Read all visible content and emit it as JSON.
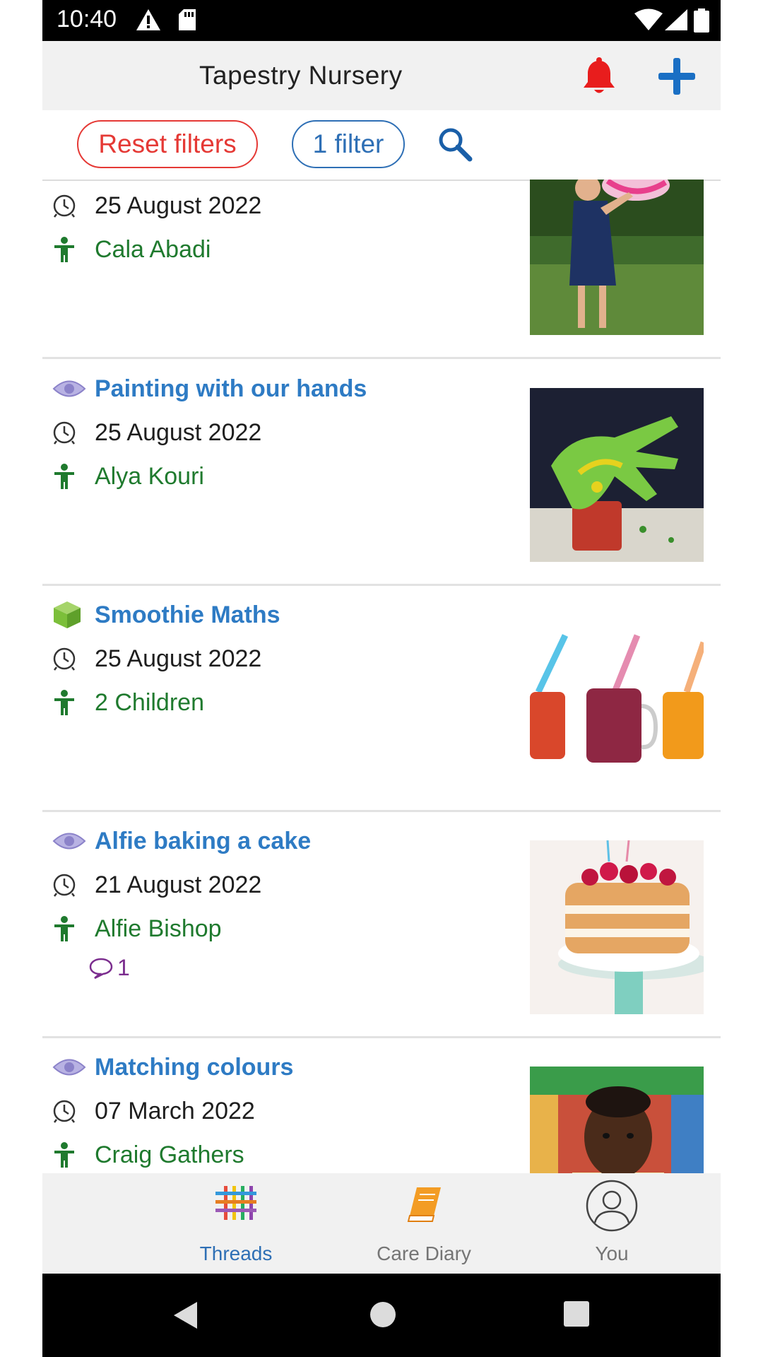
{
  "status_bar": {
    "time": "10:40"
  },
  "app_bar": {
    "title": "Tapestry Nursery",
    "bell_color": "#e81d1d",
    "add_color": "#1a6fc4"
  },
  "filters": {
    "reset_label": "Reset filters",
    "filter_label": "1 filter"
  },
  "entries": [
    {
      "title": "",
      "date": "25 August 2022",
      "child": "Cala Abadi",
      "status_icon": "none",
      "image": "girl-with-beach-ball"
    },
    {
      "title": "Painting with our hands",
      "date": "25 August 2022",
      "child": "Alya Kouri",
      "status_icon": "eye-icon",
      "image": "painted-hand"
    },
    {
      "title": "Smoothie Maths",
      "date": "25 August 2022",
      "child": "2 Children",
      "status_icon": "cube-icon",
      "image": "smoothie-jars"
    },
    {
      "title": "Alfie baking a cake",
      "date": "21 August 2022",
      "child": "Alfie Bishop",
      "status_icon": "eye-icon",
      "image": "layer-cake",
      "comments": "1"
    },
    {
      "title": "Matching colours",
      "date": "07 March 2022",
      "child": "Craig Gathers",
      "status_icon": "eye-icon",
      "image": "child-portrait"
    }
  ],
  "bottom_nav": {
    "tabs": [
      {
        "label": "Threads",
        "active": true
      },
      {
        "label": "Care Diary",
        "active": false
      },
      {
        "label": "You",
        "active": false
      }
    ]
  },
  "colors": {
    "title_blue": "#2e7bc4",
    "child_green": "#1f7a2e",
    "reset_red": "#e53935",
    "filter_blue": "#2e6fb5",
    "comment_purple": "#7b2d8e"
  }
}
